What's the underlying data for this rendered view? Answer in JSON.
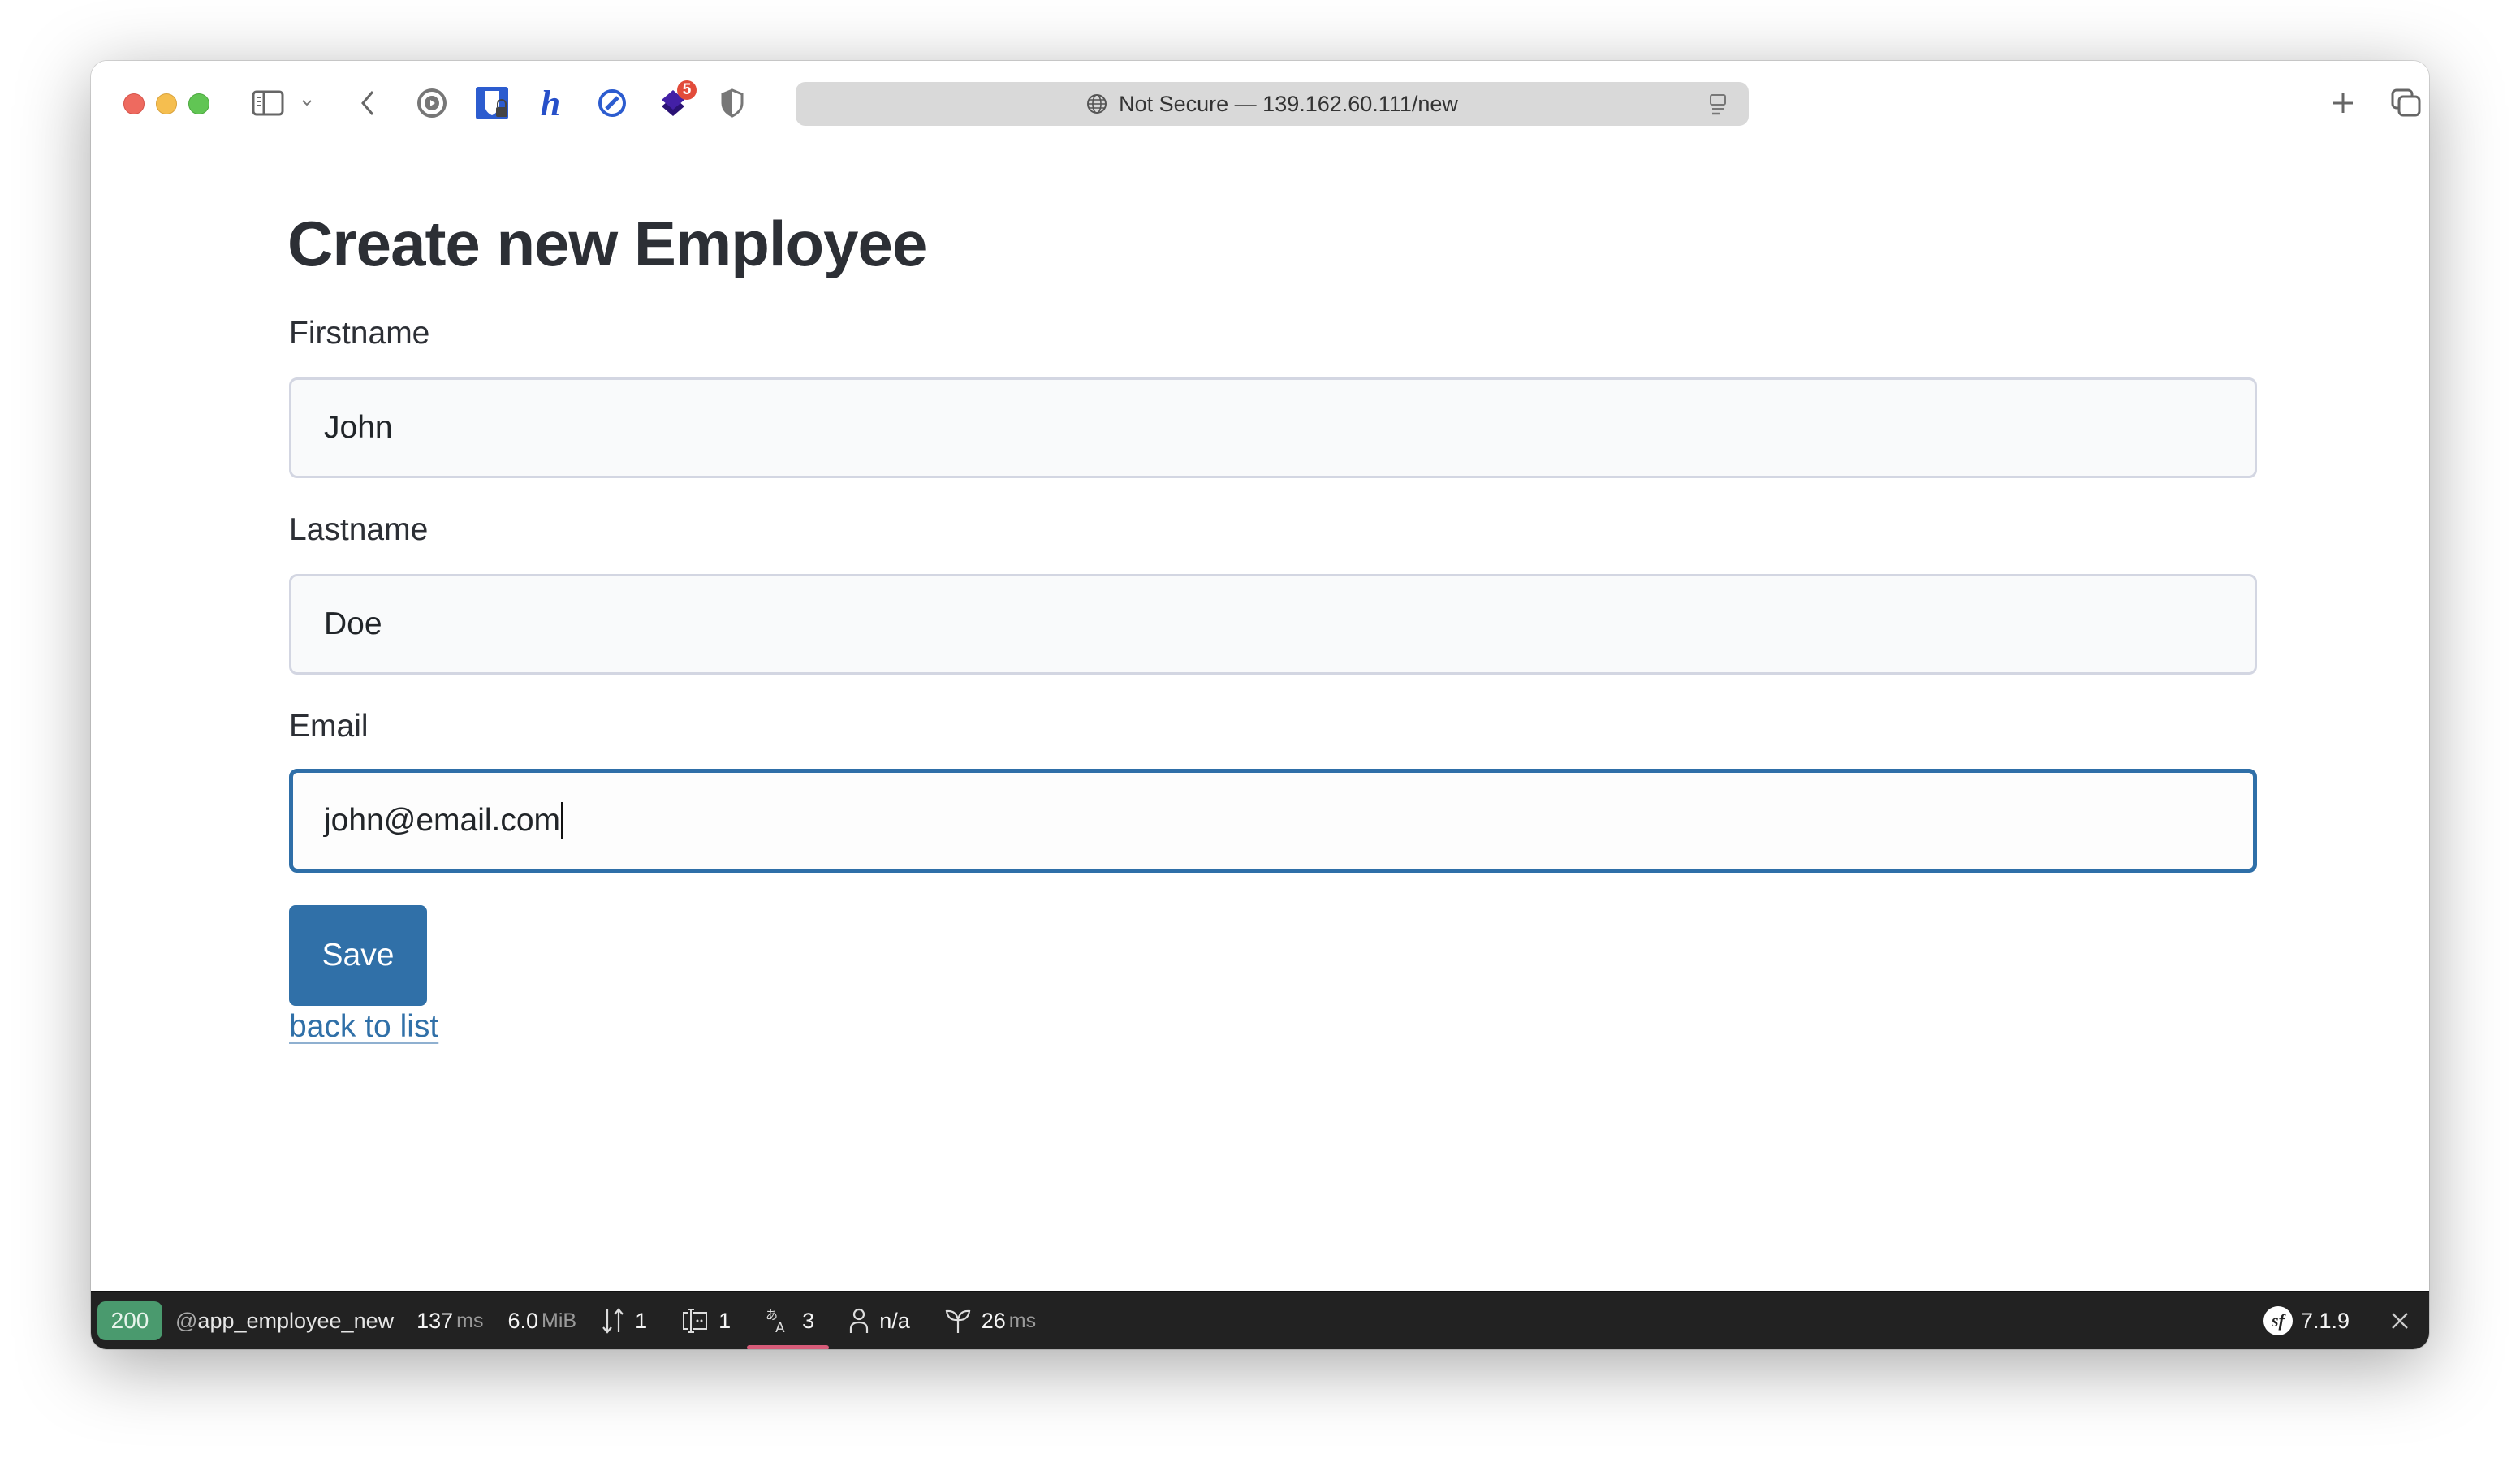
{
  "browser": {
    "url_display": "Not Secure — 139.162.60.111/new",
    "extension_badge_count": "5",
    "icons": [
      "sidebar-icon",
      "chevron-down-icon",
      "back-icon",
      "record-icon",
      "bitwarden-icon",
      "hypothesis-icon",
      "disable-icon",
      "stack-extension-icon",
      "shield-icon",
      "globe-icon",
      "reader-icon",
      "new-tab-icon",
      "tab-overview-icon"
    ]
  },
  "page": {
    "title": "Create new Employee",
    "fields": [
      {
        "label": "Firstname",
        "value": "John"
      },
      {
        "label": "Lastname",
        "value": "Doe"
      },
      {
        "label": "Email",
        "value": "john@email.com"
      }
    ],
    "save_label": "Save",
    "back_link": "back to list"
  },
  "debug_toolbar": {
    "status_code": "200",
    "route_prefix": "@",
    "route": "app_employee_new",
    "time_value": "137",
    "time_unit": "ms",
    "memory_value": "6.0",
    "memory_unit": "MiB",
    "requests_count": "1",
    "forms_count": "1",
    "translations_count": "3",
    "user": "n/a",
    "twig_value": "26",
    "twig_unit": "ms",
    "symfony_version": "7.1.9"
  },
  "colors": {
    "primary": "#3070a8",
    "status_ok": "#4a9a6e",
    "toolbar_bg": "#222222",
    "active_underline": "#d75c79"
  }
}
